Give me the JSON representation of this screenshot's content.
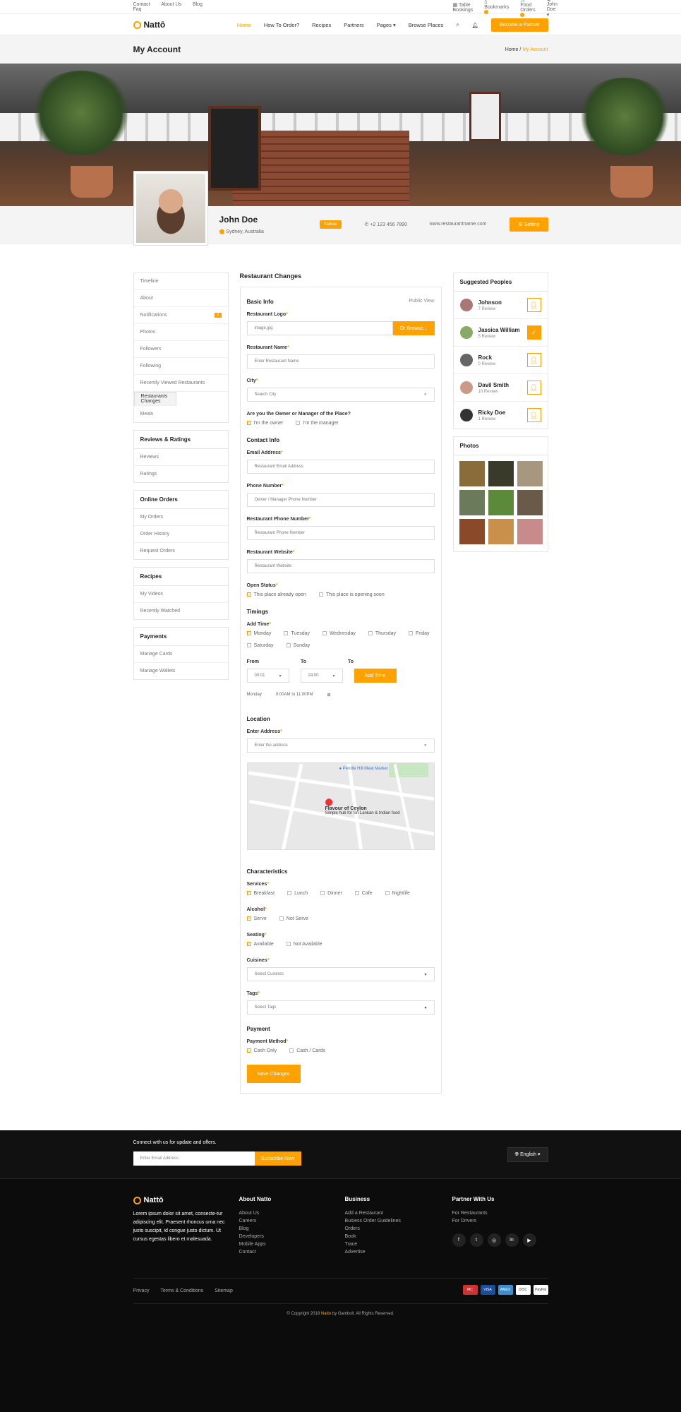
{
  "topbar": {
    "links": [
      "Contact",
      "About Us",
      "Blog",
      "Faq"
    ],
    "table_bookings": "Table Bookings",
    "bookmarks": "Bookmarks",
    "food_orders": "Food Orders",
    "user": "John Doe"
  },
  "nav": {
    "logo": "Nattō",
    "items": [
      "Home",
      "How To Order?",
      "Recipes",
      "Partners",
      "Pages",
      "Browse Places"
    ],
    "become_partner": "Become a Partner"
  },
  "titlebar": {
    "title": "My Account",
    "crumb_home": "Home",
    "crumb_sep": "/",
    "crumb_current": "My Account"
  },
  "profile": {
    "name": "John Doe",
    "location": "Sydney, Australia",
    "tag": "Partner",
    "phone": "+2 123 456 7890",
    "website": "www.restaurantname.com",
    "setting": "Setting"
  },
  "sidebar": {
    "main": [
      {
        "label": "Timeline"
      },
      {
        "label": "About"
      },
      {
        "label": "Notifications",
        "badge": "2"
      },
      {
        "label": "Photos"
      },
      {
        "label": "Followers"
      },
      {
        "label": "Following"
      },
      {
        "label": "Recently Viewed Restaurants"
      },
      {
        "label": "Restaurants Changes"
      },
      {
        "label": "Meals"
      }
    ],
    "reviews": {
      "title": "Reviews & Ratings",
      "items": [
        "Reviews",
        "Ratings"
      ]
    },
    "orders": {
      "title": "Online Orders",
      "items": [
        "My Orders",
        "Order History",
        "Request Orders"
      ]
    },
    "recipes": {
      "title": "Recipes",
      "items": [
        "My Videos",
        "Recently Watched"
      ]
    },
    "payments": {
      "title": "Payments",
      "items": [
        "Manage Cards",
        "Manage Wallets"
      ]
    }
  },
  "form": {
    "heading": "Restaurant Changes",
    "basic": "Basic Info",
    "public_view": "Public View",
    "logo_label": "Restaurant Logo",
    "logo_value": "image.jpg",
    "browse": "Or Browse...",
    "name_label": "Restaurant Name",
    "name_ph": "Enter Restaurant Name",
    "city_label": "City",
    "city_ph": "Search City",
    "owner_q": "Are you the Owner or Manager of the Place?",
    "owner_opts": [
      "I'm the owner",
      "I'm the manager"
    ],
    "contact": "Contact Info",
    "email_label": "Email Address",
    "email_ph": "Restaurant Email Address",
    "phone_label": "Phone Number",
    "phone_ph": "Owner / Manager Phone Number",
    "rphone_label": "Restaurant Phone Number",
    "rphone_ph": "Restaurant Phone Number",
    "web_label": "Restaurant Website",
    "web_ph": "Restaurant Website",
    "open_label": "Open Status",
    "open_opts": [
      "This place already open",
      "This place is opening soon"
    ],
    "timings": "Timings",
    "add_time": "Add Time",
    "days": [
      "Monday",
      "Tuesday",
      "Wednesday",
      "Thursday",
      "Friday",
      "Saturday",
      "Sunday"
    ],
    "from": "From",
    "to": "To",
    "to2": "To",
    "from_val": "00:01",
    "to_val": "24:00",
    "add_btn": "Add Time",
    "sched_day": "Monday",
    "sched_time": "9:00AM to 11:00PM",
    "sched_x": "⊠",
    "location": "Location",
    "addr_label": "Enter Address",
    "addr_ph": "Enter the address",
    "map_market": "Pendle Hill Meat Market",
    "map_place": "Flavour of Ceylon",
    "map_place_sub": "Simple hub for Sri Lankan & Indian food",
    "chars": "Characteristics",
    "services_label": "Services",
    "services": [
      "Breakfast",
      "Lunch",
      "Dinner",
      "Cafe",
      "Nightlife"
    ],
    "alcohol_label": "Alcohol",
    "alcohol": [
      "Serve",
      "Not Serve"
    ],
    "seating_label": "Seating",
    "seating": [
      "Available",
      "Not Available"
    ],
    "cuisines_label": "Cuisines",
    "cuisines_ph": "Select Cuisines",
    "tags_label": "Tags",
    "tags_ph": "Select Tags",
    "payment": "Payment",
    "pm_label": "Payment Method",
    "pm": [
      "Cash Only",
      "Cash / Cards"
    ],
    "save": "Save Changes"
  },
  "suggested": {
    "title": "Suggested Peoples",
    "people": [
      {
        "name": "Johnson",
        "rev": "7 Review"
      },
      {
        "name": "Jassica William",
        "rev": "5 Review"
      },
      {
        "name": "Rock",
        "rev": "0 Review"
      },
      {
        "name": "Davil Smith",
        "rev": "10 Review"
      },
      {
        "name": "Ricky Doe",
        "rev": "1 Review"
      }
    ]
  },
  "photos": {
    "title": "Photos"
  },
  "footer": {
    "connect": "Connect with us for update and offers.",
    "email_ph": "Enter Email Address",
    "subscribe": "Subscribe Now",
    "lang": "English",
    "logo": "Nattō",
    "about_text": "Lorem ipsum dolor sit amet, consecte-tur adipiscing elit. Praesent rhoncus urna nec justo suscipit, id congue justo dictum. Ut cursus egestas libero et malesuada.",
    "about_title": "About Natto",
    "about_links": [
      "About Us",
      "Careers",
      "Blog",
      "Developers",
      "Mobile Apps",
      "Contact"
    ],
    "biz_title": "Business",
    "biz_links": [
      "Add a Restaurant",
      "Busiess Order Guidelines",
      "Orders",
      "Book",
      "Trace",
      "Advertise"
    ],
    "partner_title": "Partner With Us",
    "partner_links": [
      "For Restaurants",
      "For Drivers"
    ],
    "bottom_links": [
      "Privacy",
      "Terms & Conditions",
      "Sitemap"
    ],
    "cards": [
      "MC",
      "VISA",
      "AMEX",
      "DISC",
      "PayPal"
    ],
    "copy_pre": "© Copyright 2018",
    "copy_brand": "Natto",
    "copy_post": "by Gamboli. All Rights Reserved."
  }
}
